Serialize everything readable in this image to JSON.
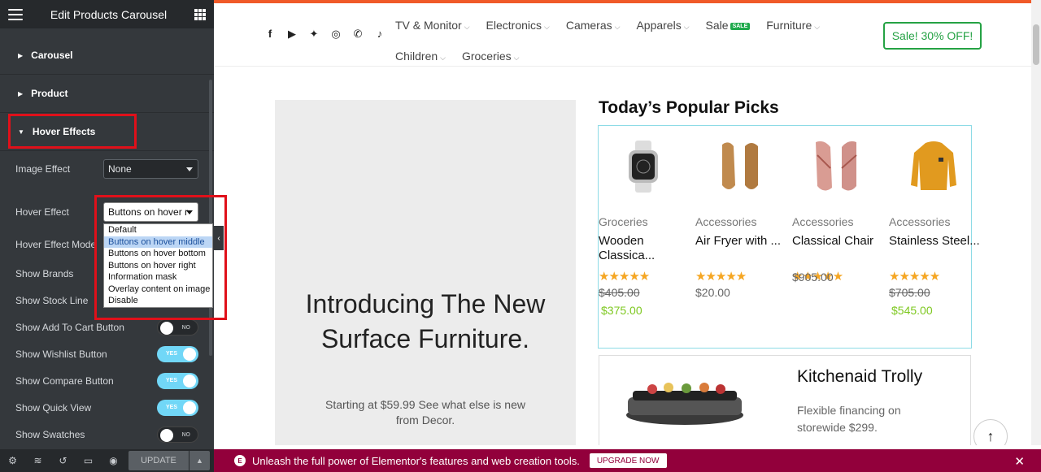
{
  "panel": {
    "title": "Edit Products Carousel",
    "sections": {
      "carousel": "Carousel",
      "product": "Product",
      "hover_effects": "Hover Effects"
    },
    "controls": {
      "image_effect_label": "Image Effect",
      "image_effect_value": "None",
      "hover_effect_label": "Hover Effect",
      "hover_effect_value": "Buttons on hover r",
      "hover_effect_options": [
        "Default",
        "Buttons on hover middle",
        "Buttons on hover bottom",
        "Buttons on hover right",
        "Information mask",
        "Overlay content on image",
        "Disable"
      ],
      "hover_effect_highlighted": "Buttons on hover middle",
      "hover_effect_mode_label": "Hover Effect Mode",
      "show_brands_label": "Show Brands",
      "show_stock_line_label": "Show Stock Line",
      "show_add_to_cart_label": "Show Add To Cart Button",
      "show_add_to_cart_state": "NO",
      "show_wishlist_label": "Show Wishlist Button",
      "show_wishlist_state": "YES",
      "show_compare_label": "Show Compare Button",
      "show_compare_state": "YES",
      "show_quick_view_label": "Show Quick View",
      "show_quick_view_state": "YES",
      "show_swatches_label": "Show Swatches",
      "show_swatches_state": "NO"
    },
    "footer": {
      "update_label": "UPDATE"
    }
  },
  "site": {
    "socials": [
      "facebook-icon",
      "youtube-icon",
      "twitter-icon",
      "instagram-icon",
      "whatsapp-icon",
      "tiktok-icon"
    ],
    "nav_row1": [
      "TV & Monitor",
      "Electronics",
      "Cameras",
      "Apparels",
      "Sale",
      "Furniture"
    ],
    "nav_sale_badge": "SALE",
    "nav_row2": [
      "Children",
      "Groceries"
    ],
    "sale_button": "Sale! 30% OFF!",
    "banner": {
      "title": "Introducing The New Surface Furniture.",
      "subtitle": "Starting at $59.99 See what else is new from Decor."
    },
    "popular_title": "Today’s Popular Picks",
    "products": [
      {
        "category": "Groceries",
        "name": "Wooden Classica...",
        "stars": "★★★★★",
        "old_price": "$405.00",
        "price": "$375.00"
      },
      {
        "category": "Accessories",
        "name": "Air Fryer with ...",
        "stars": "★★★★★",
        "old_price": "",
        "price": "$20.00"
      },
      {
        "category": "Accessories",
        "name": "Classical Chair",
        "stars": "★★★★★",
        "old_price": "",
        "price": "$905.00"
      },
      {
        "category": "Accessories",
        "name": "Stainless Steel...",
        "stars": "★★★★★",
        "old_price": "$705.00",
        "price": "$545.00"
      }
    ],
    "kitchen": {
      "title": "Kitchenaid Trolly",
      "desc": "Flexible financing on storewide $299."
    }
  },
  "promo": {
    "text": "Unleash the full power of Elementor's features and web creation tools.",
    "upgrade": "UPGRADE NOW"
  },
  "colors": {
    "accent_orange": "#f05a28",
    "sale_green": "#25a244",
    "promo_bg": "#92003b",
    "highlight_red": "#e0101a",
    "toggle_on": "#71d7f7",
    "price_green": "#7ec820",
    "star": "#f5a623"
  }
}
